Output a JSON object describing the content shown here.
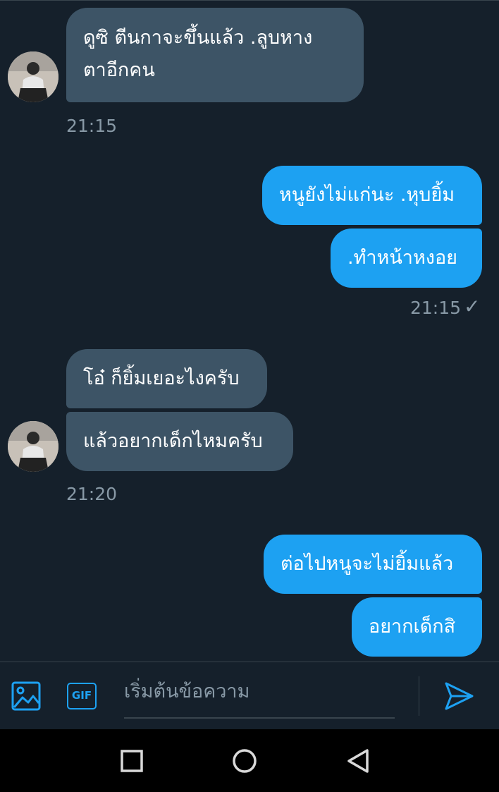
{
  "messages": [
    {
      "id": "m1",
      "direction": "in",
      "text_line1": "ดูซิ ตีนกาจะขึ้นแล้ว .ลูบหาง",
      "text_line2": "ตาอีกคน"
    },
    {
      "id": "t1",
      "timestamp": "21:15"
    },
    {
      "id": "m2",
      "direction": "out",
      "text": "หนูยังไม่แก่นะ .หุบยิ้ม"
    },
    {
      "id": "m3",
      "direction": "out",
      "text": ".ทำหน้าหงอย"
    },
    {
      "id": "t2",
      "timestamp": "21:15",
      "status": "sent"
    },
    {
      "id": "m4",
      "direction": "in",
      "text": "โอ๋ ก็ยิ้มเยอะไงครับ"
    },
    {
      "id": "m5",
      "direction": "in",
      "text": "แล้วอยากเด็กไหมครับ"
    },
    {
      "id": "t3",
      "timestamp": "21:20"
    },
    {
      "id": "m6",
      "direction": "out",
      "text": "ต่อไปหนูจะไม่ยิ้มแล้ว"
    },
    {
      "id": "m7",
      "direction": "out",
      "text": "อยากเด็กสิ"
    }
  ],
  "composer": {
    "placeholder": "เริ่มต้นข้อความ",
    "gif_label": "GIF",
    "media_icon": "image-icon",
    "send_icon": "send-icon"
  },
  "navbar": {
    "buttons": [
      "recents-icon",
      "home-icon",
      "back-icon"
    ]
  },
  "colors": {
    "background": "#15202b",
    "incoming_bubble": "#3d5466",
    "outgoing_bubble": "#1da1f2",
    "secondary_text": "#8899a6",
    "accent": "#1da1f2"
  }
}
